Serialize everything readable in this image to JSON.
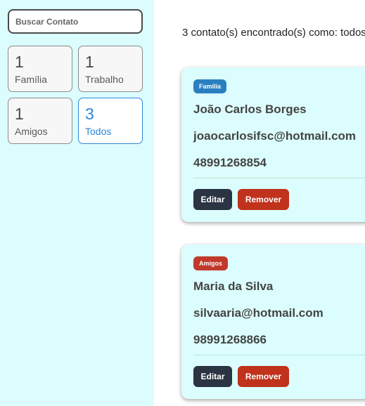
{
  "search": {
    "placeholder": "Buscar Contato"
  },
  "filters": [
    {
      "count": "1",
      "label": "Família"
    },
    {
      "count": "1",
      "label": "Trabalho"
    },
    {
      "count": "1",
      "label": "Amigos"
    },
    {
      "count": "3",
      "label": "Todos"
    }
  ],
  "results_text": "3 contato(s) encontrado(s) como: todos",
  "contacts": [
    {
      "category": "Família",
      "name": "João Carlos Borges",
      "email": "joaocarlosifsc@hotmail.com",
      "phone": "48991268854",
      "edit_label": "Editar",
      "remove_label": "Remover"
    },
    {
      "category": "Amigos",
      "name": "Maria da Silva",
      "email": "silvaaria@hotmail.com",
      "phone": "98991268866",
      "edit_label": "Editar",
      "remove_label": "Remover"
    }
  ],
  "colors": {
    "sidebar_bg": "#dcfdfd",
    "card_bg": "#dcfdfd",
    "active_accent": "#2a86d6",
    "familia_badge": "#2a7fc1",
    "amigos_badge": "#c0392b",
    "edit_button": "#2b3442",
    "remove_button": "#c0321c"
  }
}
